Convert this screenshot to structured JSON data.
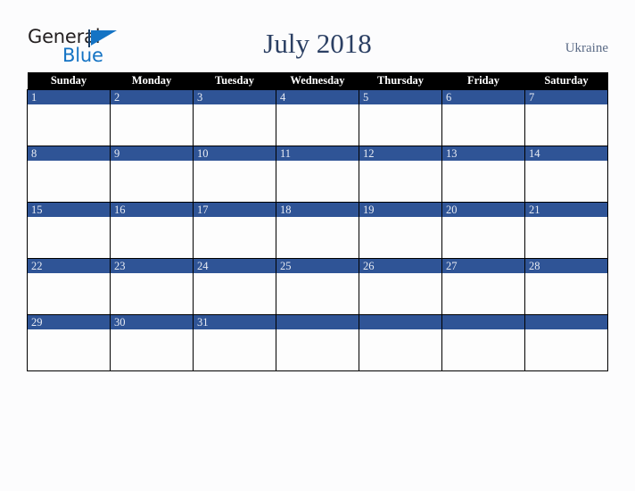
{
  "brand": {
    "name_part1": "General",
    "name_part2": "Blue",
    "mark": "triangle-logo"
  },
  "header": {
    "title": "July 2018",
    "region": "Ukraine"
  },
  "colors": {
    "accent_blue": "#2f5496",
    "header_bar": "#000000",
    "title_text": "#2b3f63",
    "region_text": "#5b6b86",
    "logo_blue": "#1473c4",
    "page_background": "#fcfcfd",
    "cell_background": "#fdfdfd",
    "grid_line": "#000000"
  },
  "calendar": {
    "month": "July",
    "year": "2018",
    "weekday_headers": [
      "Sunday",
      "Monday",
      "Tuesday",
      "Wednesday",
      "Thursday",
      "Friday",
      "Saturday"
    ],
    "weeks": [
      [
        "1",
        "2",
        "3",
        "4",
        "5",
        "6",
        "7"
      ],
      [
        "8",
        "9",
        "10",
        "11",
        "12",
        "13",
        "14"
      ],
      [
        "15",
        "16",
        "17",
        "18",
        "19",
        "20",
        "21"
      ],
      [
        "22",
        "23",
        "24",
        "25",
        "26",
        "27",
        "28"
      ],
      [
        "29",
        "30",
        "31",
        "",
        "",
        "",
        ""
      ]
    ],
    "events": []
  }
}
